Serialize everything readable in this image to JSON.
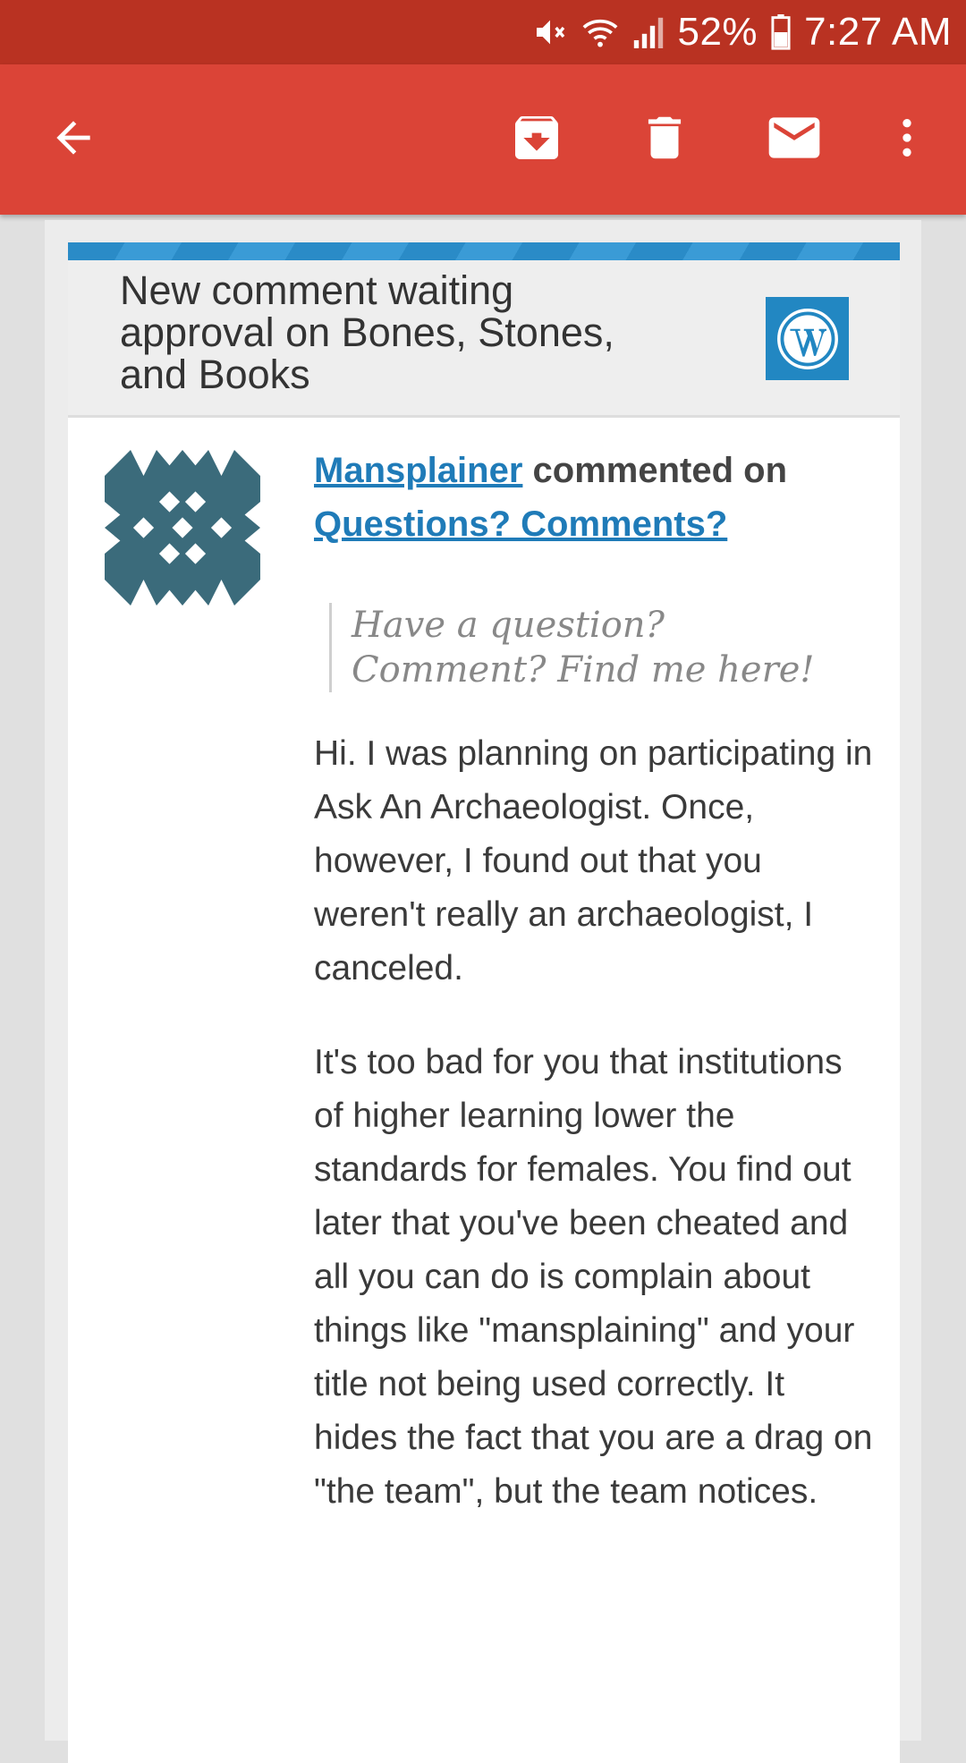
{
  "status_bar": {
    "battery_percent": "52%",
    "time": "7:27 AM",
    "icons": [
      "mute-icon",
      "wifi-icon",
      "signal-icon",
      "battery-icon"
    ]
  },
  "toolbar": {
    "back_icon": "arrow-left-icon",
    "archive_icon": "archive-icon",
    "delete_icon": "trash-icon",
    "mail_icon": "mail-icon",
    "more_icon": "more-vert-icon"
  },
  "email": {
    "header_title": "New comment waiting approval on Bones, Stones, and Books",
    "logo_icon": "wordpress-logo",
    "commenter": "Mansplainer",
    "commented_on_text": "commented on",
    "post_title": "Questions? Comments?",
    "quote": "Have a question? Comment? Find me here!",
    "paragraphs": [
      "Hi. I was planning on participating in Ask An Archaeologist. Once, however, I found out that you weren't really an archaeologist, I canceled.",
      "It's too bad for you that institutions of higher learning lower the standards for females. You find out later that you've been cheated and all you can do is complain about things like \"mansplaining\" and your title not being used correctly. It hides the fact that you are a drag on \"the team\", but the team notices."
    ]
  },
  "colors": {
    "status_bar": "#b93222",
    "app_bar": "#db4437",
    "wordpress_blue": "#2287c2",
    "link": "#1f7bb8"
  }
}
